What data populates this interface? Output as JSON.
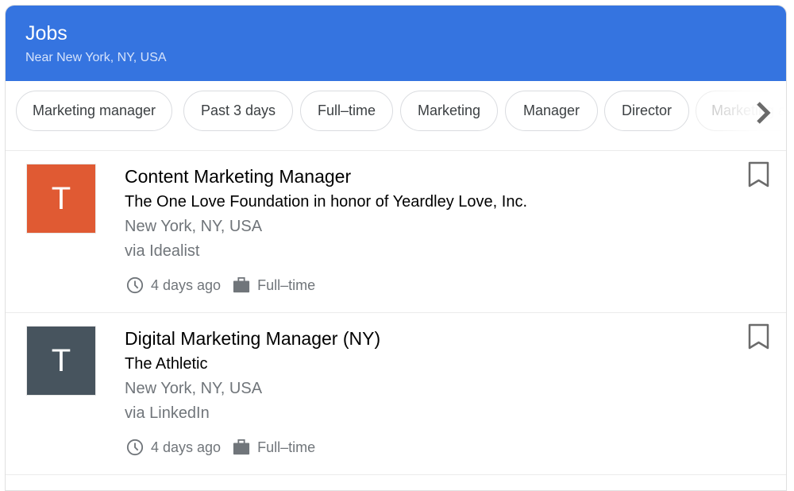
{
  "header": {
    "title": "Jobs",
    "subtitle": "Near New York, NY, USA",
    "color": "#3574e0"
  },
  "chips": [
    {
      "label": "Marketing manager"
    },
    {
      "label": "Past 3 days"
    },
    {
      "label": "Full–time"
    },
    {
      "label": "Marketing"
    },
    {
      "label": "Manager"
    },
    {
      "label": "Director"
    },
    {
      "label": "Marketing a"
    }
  ],
  "chips_next_icon": "chevron-right-icon",
  "jobs": [
    {
      "logo_letter": "T",
      "logo_color": "#e05a33",
      "title": "Content Marketing Manager",
      "company": "The One Love Foundation in honor of Yeardley Love, Inc.",
      "location": "New York, NY, USA",
      "via": "via Idealist",
      "posted": "4 days ago",
      "type": "Full–time"
    },
    {
      "logo_letter": "T",
      "logo_color": "#47545e",
      "title": "Digital Marketing Manager (NY)",
      "company": "The Athletic",
      "location": "New York, NY, USA",
      "via": "via LinkedIn",
      "posted": "4 days ago",
      "type": "Full–time"
    }
  ]
}
